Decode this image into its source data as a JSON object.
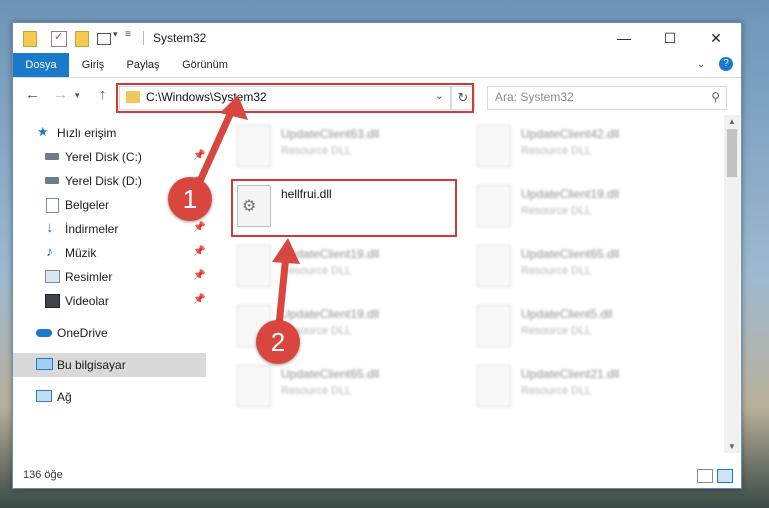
{
  "window": {
    "title": "System32"
  },
  "ribbon": {
    "tabs": [
      "Dosya",
      "Giriş",
      "Paylaş",
      "Görünüm"
    ]
  },
  "navigation": {
    "address_path": "C:\\Windows\\System32",
    "search_placeholder": "Ara: System32"
  },
  "sidebar": {
    "items": [
      {
        "label": "Hızlı erişim",
        "icon": "star-icon"
      },
      {
        "label": "Yerel Disk (C:)",
        "icon": "drive-icon",
        "pinned": true
      },
      {
        "label": "Yerel Disk (D:)",
        "icon": "drive-icon",
        "pinned": true
      },
      {
        "label": "Belgeler",
        "icon": "document-icon",
        "pinned": true
      },
      {
        "label": "İndirmeler",
        "icon": "download-icon",
        "pinned": true
      },
      {
        "label": "Müzik",
        "icon": "music-icon",
        "pinned": true
      },
      {
        "label": "Resimler",
        "icon": "pictures-icon",
        "pinned": true
      },
      {
        "label": "Videolar",
        "icon": "video-icon",
        "pinned": true
      },
      {
        "label": "OneDrive",
        "icon": "cloud-icon"
      },
      {
        "label": "Bu bilgisayar",
        "icon": "computer-icon"
      },
      {
        "label": "Ağ",
        "icon": "network-icon"
      }
    ]
  },
  "files": {
    "col1": [
      {
        "name": "UpdateClient63.dll",
        "type": "Resource DLL"
      },
      {
        "name": "hellfrui.dll",
        "type": ""
      },
      {
        "name": "UpdateClient19.dll",
        "type": "Resource DLL"
      },
      {
        "name": "UpdateClient19.dll",
        "type": "Resource DLL"
      },
      {
        "name": "UpdateClient65.dll",
        "type": "Resource DLL"
      }
    ],
    "col2": [
      {
        "name": "UpdateClient42.dll",
        "type": "Resource DLL"
      },
      {
        "name": "UpdateClient19.dll",
        "type": "Resource DLL"
      },
      {
        "name": "UpdateClient65.dll",
        "type": "Resource DLL"
      },
      {
        "name": "UpdateClient5.dll",
        "type": "Resource DLL"
      },
      {
        "name": "UpdateClient21.dll",
        "type": "Resource DLL"
      }
    ]
  },
  "status": {
    "item_count": "136 öğe"
  },
  "annotations": {
    "badge1": "1",
    "badge2": "2"
  },
  "colors": {
    "accent": "#1979ca",
    "highlight": "#d23a3a"
  }
}
